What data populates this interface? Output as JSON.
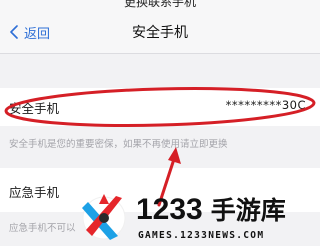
{
  "status_bar": {
    "text_cropped": "更换联系手机"
  },
  "navbar": {
    "back_label": "返回",
    "title": "安全手机"
  },
  "phone_row": {
    "label": "安全手机",
    "value": "*********30C"
  },
  "hint": "安全手机是您的重要密保，如果不再使用请立即更换",
  "emergency_row": {
    "label": "应急手机"
  },
  "hint2": "应急手机不可以",
  "watermark": {
    "brand": "1233",
    "brand_cn": "手游库",
    "url": "GAMES.1233NEWS.COM"
  },
  "colors": {
    "accent": "#2e6fd6",
    "annotation": "#d51f26",
    "background": "#f2f2f4"
  }
}
